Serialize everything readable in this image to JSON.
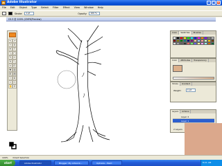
{
  "titlebar": {
    "title": "Adobe Illustrator"
  },
  "menus": [
    "File",
    "Edit",
    "Object",
    "Type",
    "Select",
    "Filter",
    "Effect",
    "View",
    "Window",
    "Help"
  ],
  "control": {
    "stroke_label": "Stroke:",
    "stroke_value": "1 pt",
    "opacity_label": "Opacity:",
    "opacity_value": "100 %"
  },
  "document": {
    "tab_title": "C0.3 @ 100% (CMYK/Preview)"
  },
  "swatches_panel": {
    "tabs": [
      "Color",
      "Swatches",
      "Brushes"
    ],
    "colors": [
      "#ffffff",
      "#000000",
      "#ff0000",
      "#ffff00",
      "#00ff00",
      "#00ffff",
      "#0000ff",
      "#ff00ff",
      "#ff8000",
      "#8000ff",
      "#808080",
      "#c0c0c0",
      "#800000",
      "#808000",
      "#008000",
      "#008080",
      "#000080",
      "#800080",
      "#ffcc99",
      "#99ccff",
      "#ff9999",
      "#ccffcc",
      "#ffcc00",
      "#663300",
      "#e0e0e0",
      "#a0a0a0",
      "#606060",
      "#303030",
      "#ff6666",
      "#66ff66",
      "#6666ff",
      "#ffff99",
      "#ff99ff",
      "#99ffff",
      "#cc6600",
      "#006633"
    ]
  },
  "color_panel": {
    "tabs": [
      "Color",
      "Attributes",
      "Transparency"
    ],
    "fill_color": "#dcb08a"
  },
  "stroke_panel": {
    "tabs": [
      "Stroke",
      "Gradient"
    ],
    "weight_label": "Weight:",
    "weight_value": "1 pt"
  },
  "layers_panel": {
    "tabs": [
      "Layers",
      "Actions"
    ],
    "layers": [
      {
        "name": "Layer 2",
        "selected": false
      },
      {
        "name": "Layer 1",
        "selected": true
      }
    ],
    "count_text": "2 Layers"
  },
  "statusbar": {
    "zoom": "100%",
    "tool": "Direct Selection"
  },
  "taskbar": {
    "start_label": "start",
    "items": [
      {
        "label": "Adobe Illustrator",
        "active": true
      },
      {
        "label": "Blogger: My Artwork...",
        "active": false
      },
      {
        "label": "Uptrade - Paint",
        "active": false
      }
    ],
    "clock": "8:21 AM"
  }
}
